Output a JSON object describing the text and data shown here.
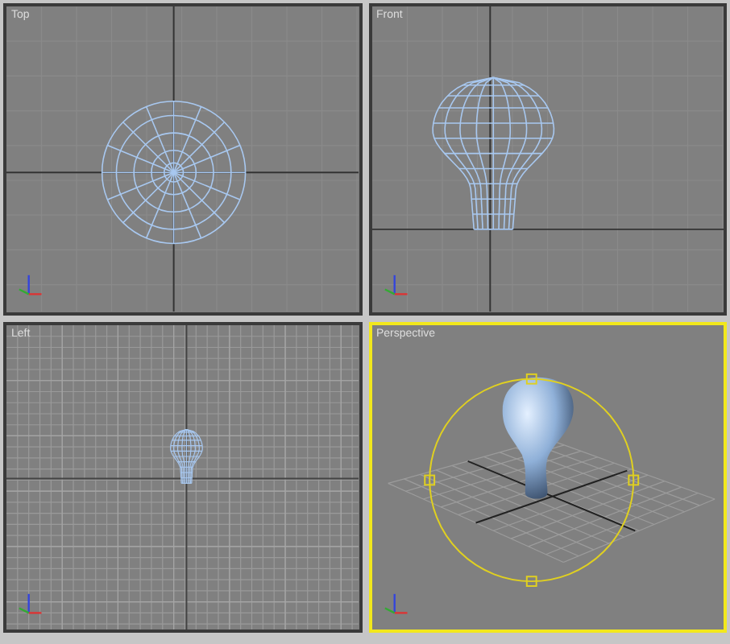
{
  "viewports": [
    {
      "label": "Top",
      "kind": "top",
      "selected": false
    },
    {
      "label": "Front",
      "kind": "front",
      "selected": false
    },
    {
      "label": "Left",
      "kind": "left",
      "selected": false
    },
    {
      "label": "Perspective",
      "kind": "perspective",
      "selected": true
    }
  ]
}
